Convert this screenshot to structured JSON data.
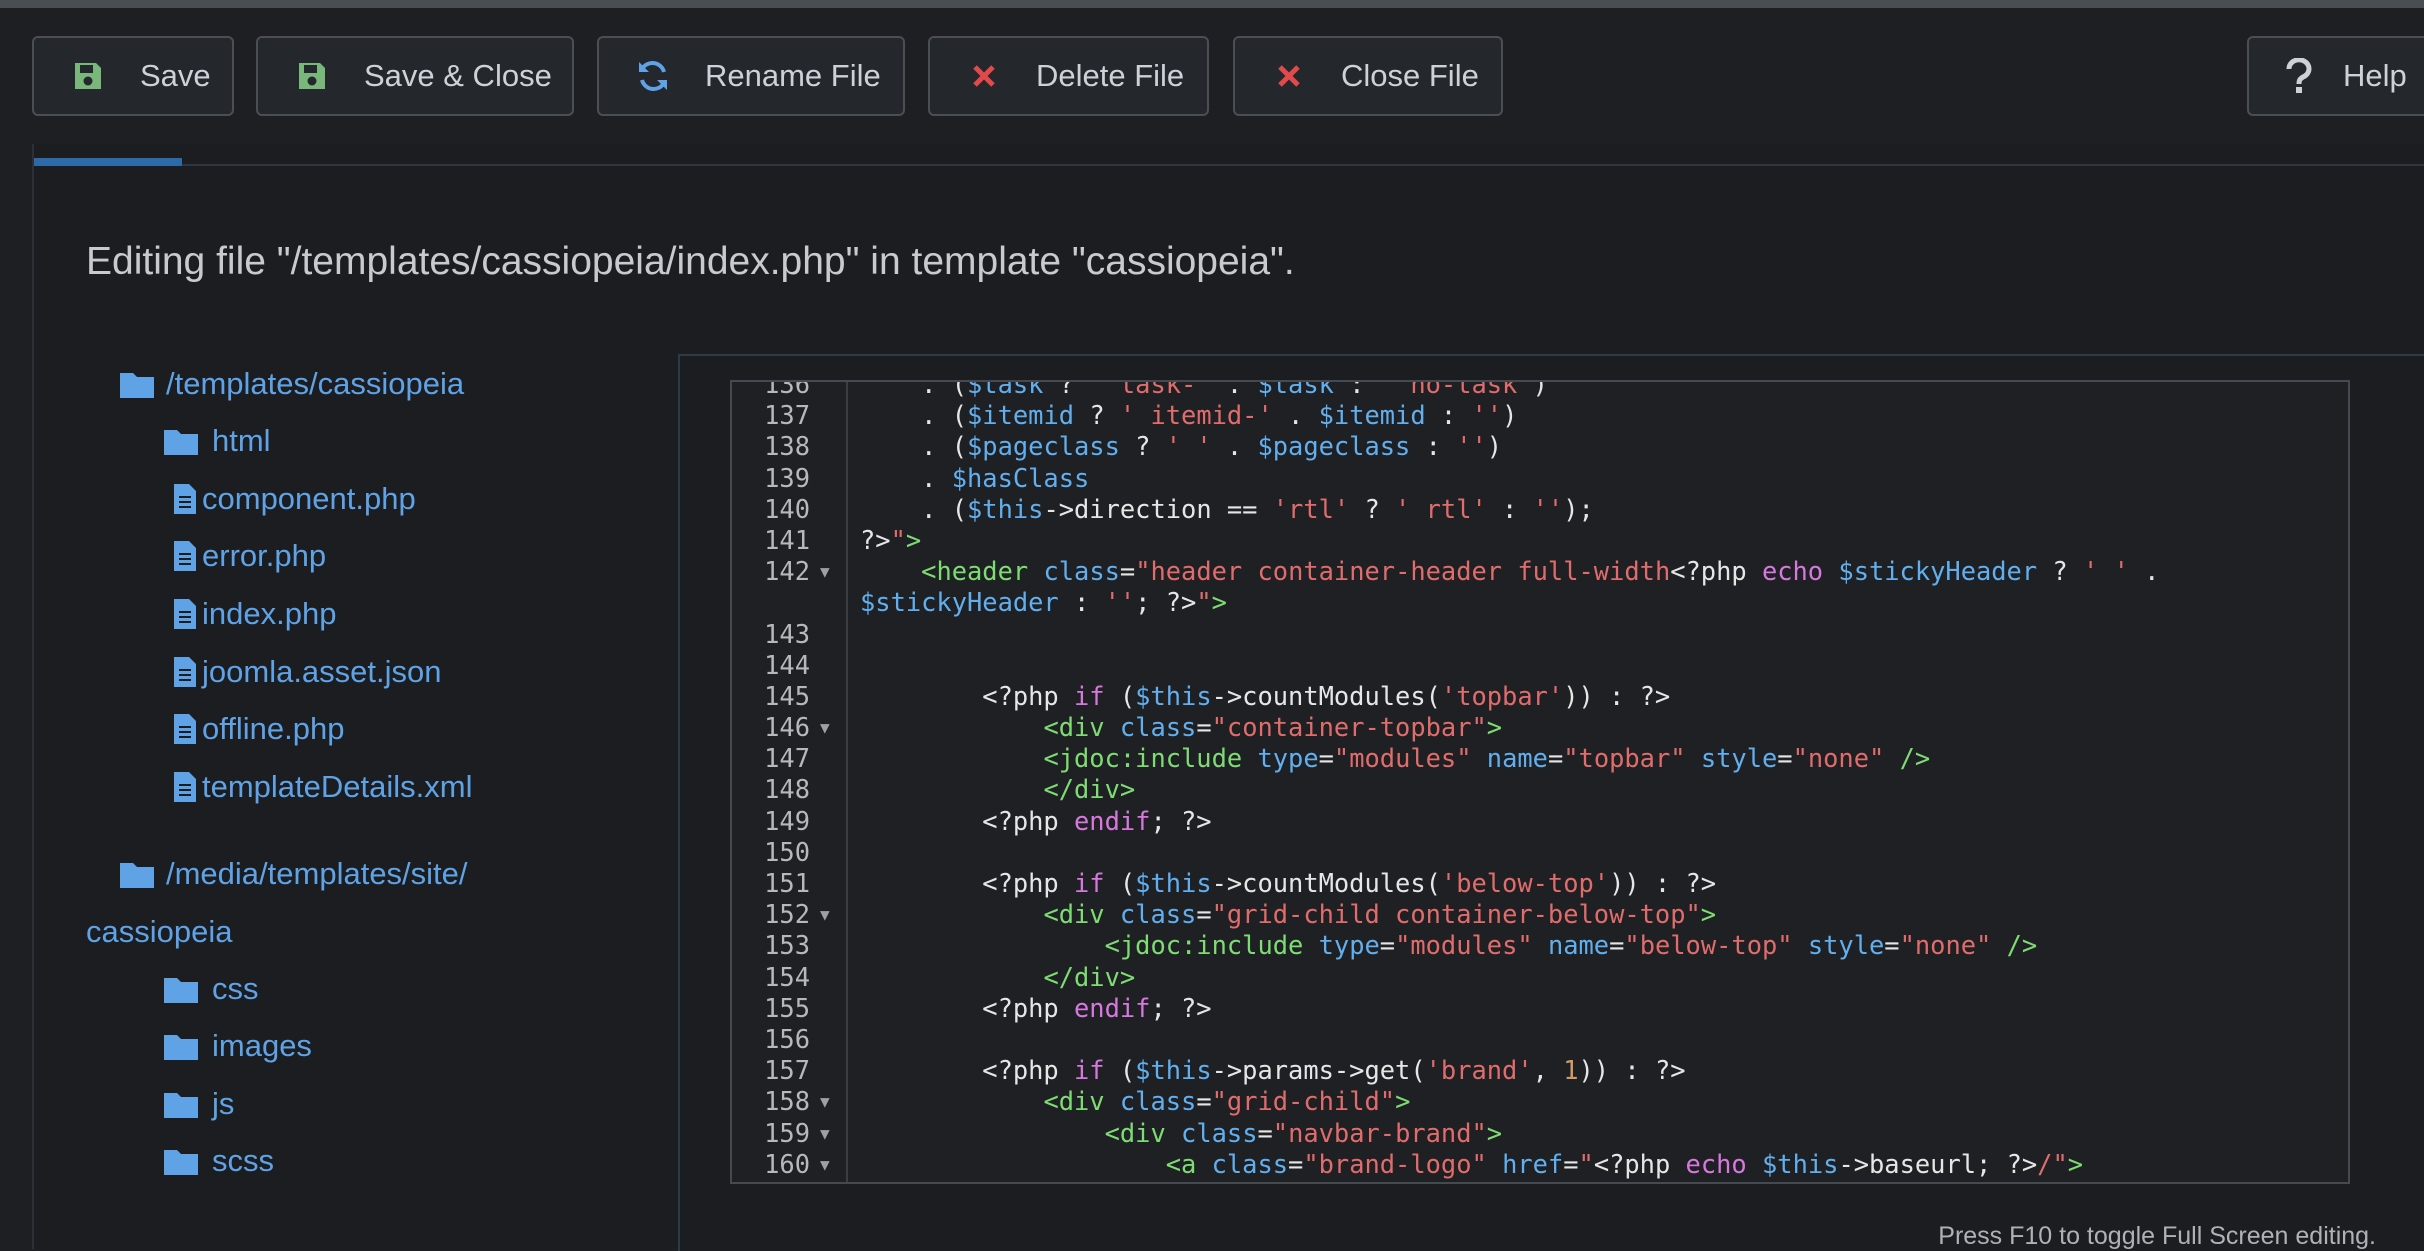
{
  "toolbar": {
    "save": "Save",
    "save_close": "Save & Close",
    "rename": "Rename File",
    "delete": "Delete File",
    "close": "Close File",
    "help": "Help"
  },
  "colors": {
    "accent": "#2d6aa8",
    "success_icon": "#7ab77a",
    "danger_icon": "#e04a4a",
    "link": "#5fa3e6"
  },
  "page": {
    "heading": "Editing file \"/templates/cassiopeia/index.php\" in template \"cassiopeia\"."
  },
  "tree": {
    "root1": "/templates/cassiopeia",
    "html": "html",
    "files": [
      "component.php",
      "error.php",
      "index.php",
      "joomla.asset.json",
      "offline.php",
      "templateDetails.xml"
    ],
    "root2_line1": "/media/templates/site/",
    "root2_line2": "cassiopeia",
    "folders2": [
      "css",
      "images",
      "js",
      "scss"
    ]
  },
  "editor": {
    "hint": "Press F10 to toggle Full Screen editing.",
    "line_numbers": [
      "136",
      "137",
      "138",
      "139",
      "140",
      "141",
      "142",
      "143",
      "144",
      "145",
      "146",
      "147",
      "148",
      "149",
      "150",
      "151",
      "152",
      "153",
      "154",
      "155",
      "156",
      "157",
      "158",
      "159",
      "160"
    ]
  }
}
